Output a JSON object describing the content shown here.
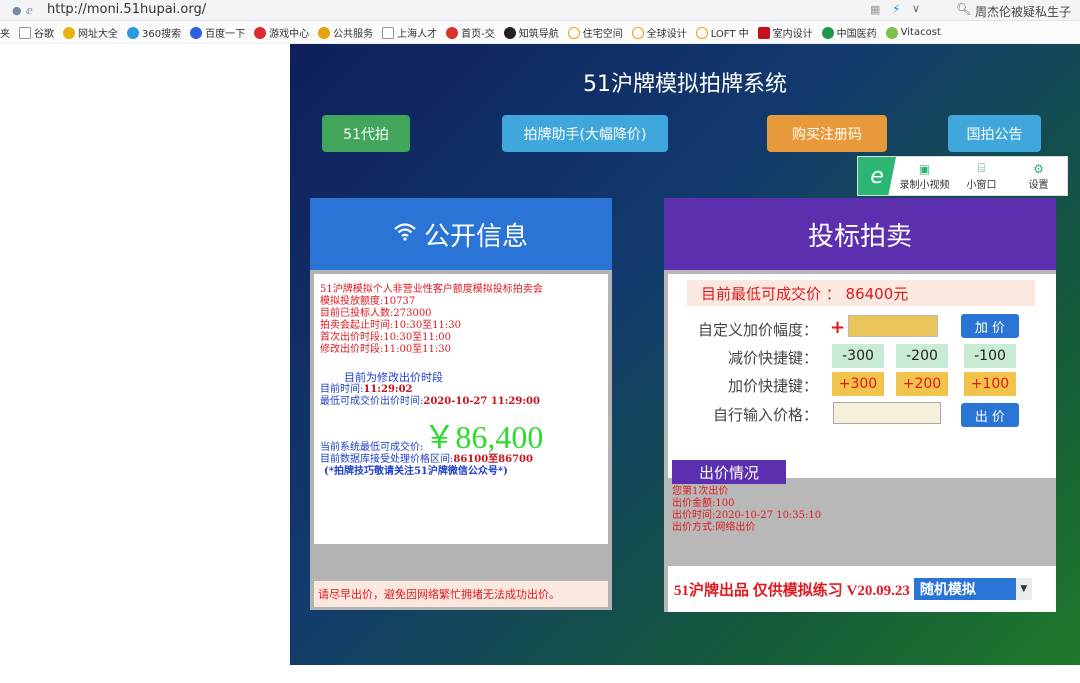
{
  "browser": {
    "url": "http://moni.51hupai.org/",
    "search_text": "周杰伦被疑私生子",
    "bookmarks": [
      "夹",
      "谷歌",
      "网址大全",
      "360搜索",
      "百度一下",
      "游戏中心",
      "公共服务",
      "上海人才",
      "首页-交",
      "知筑导航",
      "住宅空间",
      "全球设计",
      "LOFT 中",
      "室内设计",
      "中国医药",
      "Vitacost"
    ]
  },
  "site": {
    "title": "51沪牌模拟拍牌系统",
    "buttons": {
      "proxy": "51代拍",
      "assistant": "拍牌助手(大幅降价)",
      "register": "购买注册码",
      "notice": "国拍公告"
    },
    "recorder": {
      "record": "录制小视频",
      "mini_window": "小窗口",
      "settings": "设置"
    }
  },
  "public_info": {
    "header": "公开信息",
    "lines": {
      "l1": "51沪牌模拟个人非营业性客户额度模拟投标拍卖会",
      "l2": "模拟投放额度:10737",
      "l3": "目前已投标人数:273000",
      "l4": "拍卖会起止时间:10:30至11:30",
      "l5": "首次出价时段:10:30至11:00",
      "l6": "修改出价时段:11:00至11:30"
    },
    "period": "目前为修改出价时段",
    "current_time_label": "目前时间:",
    "current_time": "11:29:02",
    "lowest_time_label": "最低可成交价出价时间:",
    "lowest_time": "2020-10-27 11:29:00",
    "lowest_price_label": "当前系统最低可成交价:",
    "lowest_price": "￥86,400",
    "range_label": "目前数据库接受处理价格区间:",
    "range": "86100至86700",
    "tip": "(*拍牌技巧敬请关注51沪牌微信公众号*)",
    "footer": "请尽早出价，避免因网络繁忙拥堵无法成功出价。"
  },
  "bidding": {
    "header": "投标拍卖",
    "lowest_line": "目前最低可成交价 ： 86400元",
    "custom_label": "自定义加价幅度：",
    "add_button": "加 价",
    "minus_label": "减价快捷键：",
    "minus_options": [
      "-300",
      "-200",
      "-100"
    ],
    "plus_label": "加价快捷键：",
    "plus_options": [
      "+300",
      "+200",
      "+100"
    ],
    "manual_label": "自行输入价格：",
    "bid_button": "出 价",
    "status_tab": "出价情况",
    "log": {
      "l1": "您第1次出价",
      "l2": "出价金额:100",
      "l3": "出价时间:2020-10-27 10:35:10",
      "l4": "出价方式:网络出价"
    },
    "footer_text": "51沪牌出品 仅供模拟练习 V20.09.23",
    "mode_select": "随机模拟"
  }
}
